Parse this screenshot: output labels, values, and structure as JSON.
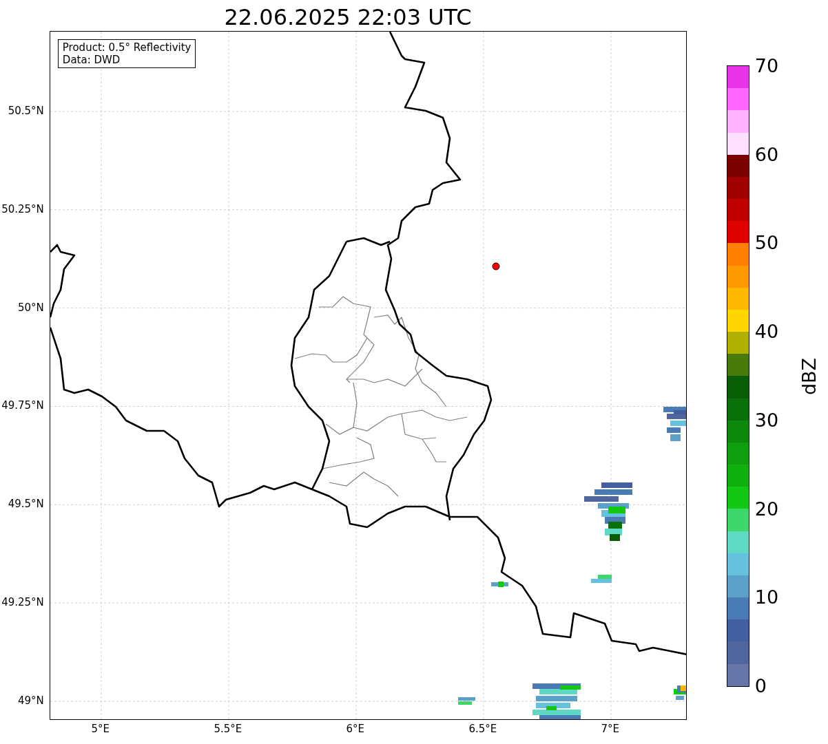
{
  "title": "22.06.2025 22:03 UTC",
  "info_box": {
    "lines": [
      "Product: 0.5° Reflectivity",
      "Data: DWD"
    ]
  },
  "map": {
    "lat_ticks": [
      "50.5°N",
      "50.25°N",
      "50°N",
      "49.75°N",
      "49.5°N",
      "49.25°N",
      "49°N"
    ],
    "lon_ticks": [
      "5°E",
      "5.5°E",
      "6°E",
      "6.5°E",
      "7°E"
    ]
  },
  "colorbar": {
    "label": "dBZ",
    "ticks": [
      "70",
      "60",
      "50",
      "40",
      "30",
      "20",
      "10",
      "0"
    ],
    "bins": [
      {
        "color": "#e935e9"
      },
      {
        "color": "#ff66ff"
      },
      {
        "color": "#ffb3ff"
      },
      {
        "color": "#ffe0ff"
      },
      {
        "color": "#7a0000"
      },
      {
        "color": "#a00000"
      },
      {
        "color": "#c00000"
      },
      {
        "color": "#e00000"
      },
      {
        "color": "#ff7f00"
      },
      {
        "color": "#ff9900"
      },
      {
        "color": "#ffb800"
      },
      {
        "color": "#ffd700"
      },
      {
        "color": "#b0b000"
      },
      {
        "color": "#4a7a0a"
      },
      {
        "color": "#075e07"
      },
      {
        "color": "#0a700a"
      },
      {
        "color": "#0c880c"
      },
      {
        "color": "#0e9e0e"
      },
      {
        "color": "#10b010"
      },
      {
        "color": "#12c812"
      },
      {
        "color": "#3dd66a"
      },
      {
        "color": "#5fd9c4"
      },
      {
        "color": "#66c1dd"
      },
      {
        "color": "#5aa0c8"
      },
      {
        "color": "#4b7bb4"
      },
      {
        "color": "#435fa0"
      },
      {
        "color": "#52669e"
      },
      {
        "color": "#6676a8"
      }
    ]
  }
}
